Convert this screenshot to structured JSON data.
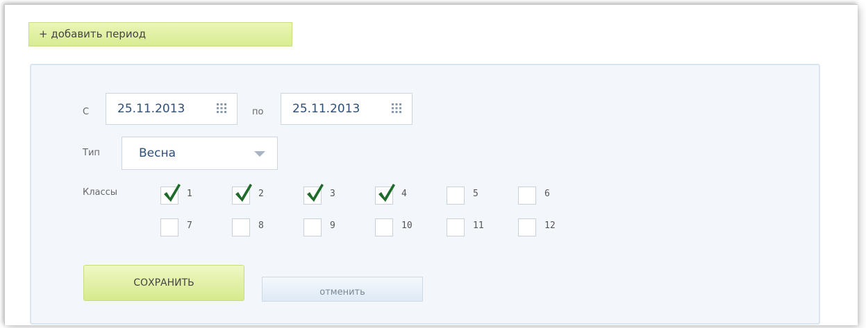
{
  "add_period_label": "+ добавить период",
  "form": {
    "from_label": "С",
    "to_label": "по",
    "from_date": "25.11.2013",
    "to_date": "25.11.2013",
    "type_label": "Тип",
    "type_value": "Весна",
    "classes_label": "Классы",
    "classes": [
      {
        "label": "1",
        "checked": true
      },
      {
        "label": "2",
        "checked": true
      },
      {
        "label": "3",
        "checked": true
      },
      {
        "label": "4",
        "checked": true
      },
      {
        "label": "5",
        "checked": false
      },
      {
        "label": "6",
        "checked": false
      },
      {
        "label": "7",
        "checked": false
      },
      {
        "label": "8",
        "checked": false
      },
      {
        "label": "9",
        "checked": false
      },
      {
        "label": "10",
        "checked": false
      },
      {
        "label": "11",
        "checked": false
      },
      {
        "label": "12",
        "checked": false
      }
    ],
    "save_label": "СОХРАНИТЬ",
    "cancel_label": "отменить"
  },
  "colors": {
    "accent_green": "#d8ec93",
    "check_green": "#1f6b2a",
    "panel_bg": "#f3f7fc",
    "text_blue": "#2d4f78"
  },
  "icons": {
    "date_picker": "calendar-grid-icon",
    "dropdown": "chevron-down-icon",
    "checked": "checkmark-icon"
  }
}
